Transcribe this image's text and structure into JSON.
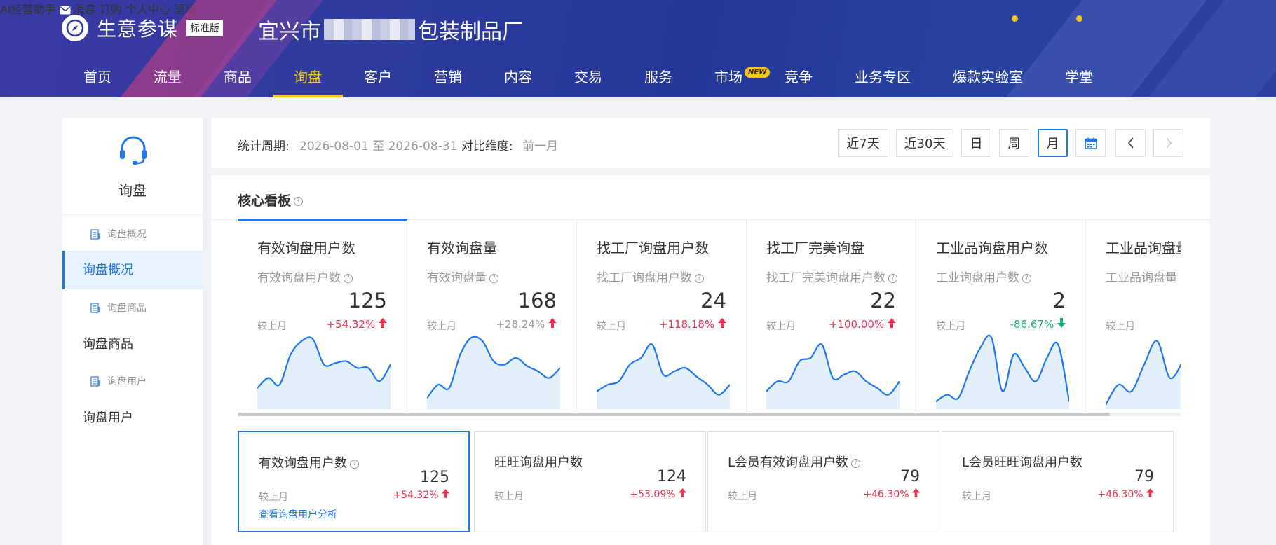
{
  "header": {
    "brand_title": "生意参谋",
    "brand_badge": "标准版",
    "shop_prefix": "宜兴市",
    "shop_suffix": "包装制品厂",
    "top_links": [
      "AI经营助手",
      "消息",
      "订购",
      "个人中心",
      "退出"
    ],
    "nav": [
      "首页",
      "流量",
      "商品",
      "询盘",
      "客户",
      "营销",
      "内容",
      "交易",
      "服务",
      "市场",
      "竞争",
      "业务专区",
      "爆款实验室",
      "学堂"
    ],
    "nav_active": "询盘",
    "new_badge": "NEW"
  },
  "sidebar": {
    "title": "询盘",
    "items": [
      {
        "type": "sub",
        "label": "询盘概况"
      },
      {
        "type": "item",
        "label": "询盘概况",
        "active": true
      },
      {
        "type": "sub",
        "label": "询盘商品"
      },
      {
        "type": "item",
        "label": "询盘商品"
      },
      {
        "type": "sub",
        "label": "询盘用户"
      },
      {
        "type": "item",
        "label": "询盘用户"
      }
    ]
  },
  "filter": {
    "period_label": "统计周期:",
    "period_value": "2026-08-01 至 2026-08-31",
    "compare_label": "对比维度:",
    "compare_value": "前一月",
    "buttons": [
      "近7天",
      "近30天",
      "日",
      "周",
      "月"
    ],
    "active_button": "月"
  },
  "board": {
    "title": "核心看板",
    "cards": [
      {
        "title": "有效询盘用户数",
        "sub": "有效询盘用户数",
        "value": "125",
        "cmp": "较上月",
        "pct": "+54.32%",
        "dir": "up"
      },
      {
        "title": "有效询盘量",
        "sub": "有效询盘量",
        "value": "168",
        "cmp": "较上月",
        "pct": "+28.24%",
        "dir": "up"
      },
      {
        "title": "找工厂询盘用户数",
        "sub": "找工厂询盘用户数",
        "value": "24",
        "cmp": "较上月",
        "pct": "+118.18%",
        "dir": "up"
      },
      {
        "title": "找工厂完美询盘",
        "sub": "找工厂完美询盘用户数",
        "value": "22",
        "cmp": "较上月",
        "pct": "+100.00%",
        "dir": "up"
      },
      {
        "title": "工业品询盘用户数",
        "sub": "工业询盘用户数",
        "value": "2",
        "cmp": "较上月",
        "pct": "-86.67%",
        "dir": "down"
      },
      {
        "title": "工业品询盘量",
        "sub": "工业品询盘量",
        "value": "",
        "cmp": "较上月",
        "pct": "",
        "dir": "up"
      }
    ],
    "sub_cards": [
      {
        "title": "有效询盘用户数",
        "value": "125",
        "cmp": "较上月",
        "pct": "+54.32%",
        "link": "查看询盘用户分析",
        "active": true,
        "help": true
      },
      {
        "title": "旺旺询盘用户数",
        "value": "124",
        "cmp": "较上月",
        "pct": "+53.09%",
        "help": false
      },
      {
        "title": "L会员有效询盘用户数",
        "value": "79",
        "cmp": "较上月",
        "pct": "+46.30%",
        "help": true
      },
      {
        "title": "L会员旺旺询盘用户数",
        "value": "79",
        "cmp": "较上月",
        "pct": "+46.30%",
        "help": false
      }
    ]
  },
  "colors": {
    "accent": "#1f78f0",
    "up": "#f0304c",
    "down": "#1bb57a",
    "nav_active": "#f5c518",
    "spark_fill": "#e3f0fc"
  },
  "sparklines": [
    [
      0.25,
      0.4,
      0.3,
      0.75,
      0.95,
      0.98,
      0.6,
      0.62,
      0.65,
      0.55,
      0.55,
      0.35,
      0.6
    ],
    [
      0.1,
      0.3,
      0.25,
      0.75,
      1.0,
      0.95,
      0.65,
      0.6,
      0.7,
      0.58,
      0.5,
      0.4,
      0.55
    ],
    [
      0.2,
      0.3,
      0.35,
      0.6,
      0.7,
      0.9,
      0.45,
      0.5,
      0.55,
      0.42,
      0.3,
      0.15,
      0.3
    ],
    [
      0.2,
      0.35,
      0.35,
      0.65,
      0.7,
      0.9,
      0.4,
      0.45,
      0.5,
      0.35,
      0.25,
      0.15,
      0.35
    ],
    [
      0.05,
      0.15,
      0.1,
      0.5,
      0.85,
      1.0,
      0.2,
      0.75,
      0.55,
      0.35,
      0.7,
      0.9,
      0.05
    ],
    [
      0.0,
      0.3,
      0.2,
      0.6,
      0.95,
      0.4,
      0.65
    ]
  ]
}
